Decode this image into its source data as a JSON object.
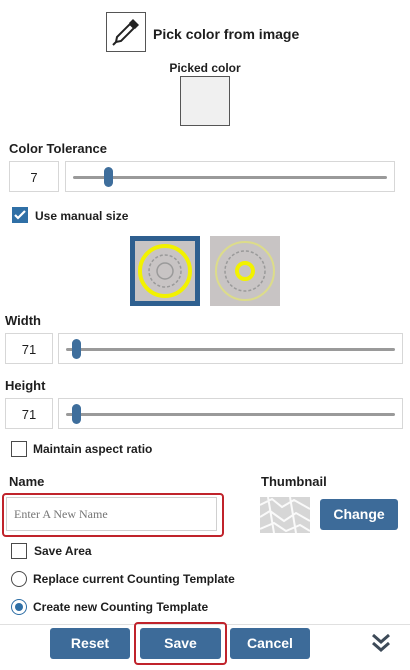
{
  "header": {
    "pick_label": "Pick color from image",
    "picked_label": "Picked color",
    "picked_color": "#f0f0f0"
  },
  "tolerance": {
    "label": "Color Tolerance",
    "value": "7",
    "level": 0.1
  },
  "manual_size": {
    "label": "Use manual size",
    "checked": true
  },
  "width": {
    "label": "Width",
    "value": "71",
    "level": 0.02
  },
  "height": {
    "label": "Height",
    "value": "71",
    "level": 0.02
  },
  "aspect": {
    "label": "Maintain aspect ratio",
    "checked": false
  },
  "name": {
    "label": "Name",
    "placeholder": "Enter A New Name"
  },
  "thumbnail": {
    "label": "Thumbnail",
    "change_label": "Change"
  },
  "save_area": {
    "label": "Save Area",
    "checked": false
  },
  "options": {
    "replace_label": "Replace current Counting Template",
    "create_label": "Create new Counting Template",
    "selected": "create"
  },
  "footer": {
    "reset_label": "Reset",
    "save_label": "Save",
    "cancel_label": "Cancel"
  },
  "colors": {
    "accent": "#3d6b99",
    "highlight": "#c0232b",
    "marker": "#f2f200"
  },
  "icons": {
    "pick": "eyedropper-icon",
    "more": "double-chevron-down-icon"
  }
}
